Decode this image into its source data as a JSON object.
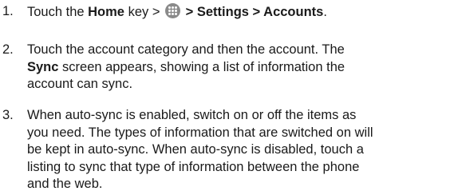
{
  "steps": [
    {
      "number": "1.",
      "lines": [
        {
          "segments": [
            {
              "text": "Touch the ",
              "bold": false
            },
            {
              "text": "Home",
              "bold": true
            },
            {
              "text": " key > ",
              "bold": false
            },
            {
              "icon": "apps-icon"
            },
            {
              "text": " > Settings > Accounts",
              "bold": true
            },
            {
              "text": ".",
              "bold": false
            }
          ]
        }
      ]
    },
    {
      "number": "2.",
      "lines": [
        {
          "segments": [
            {
              "text": "Touch the account category and then the account. The",
              "bold": false
            }
          ]
        },
        {
          "segments": [
            {
              "text": "Sync",
              "bold": true
            },
            {
              "text": " screen appears, showing a list of information the",
              "bold": false
            }
          ]
        },
        {
          "segments": [
            {
              "text": "account can sync.",
              "bold": false
            }
          ]
        }
      ]
    },
    {
      "number": "3.",
      "lines": [
        {
          "segments": [
            {
              "text": "When auto-sync is enabled, switch on or off the items as",
              "bold": false
            }
          ]
        },
        {
          "segments": [
            {
              "text": "you need. The types of information that are switched on will",
              "bold": false
            }
          ]
        },
        {
          "segments": [
            {
              "text": "be kept in auto-sync. When auto-sync is disabled, touch a",
              "bold": false
            }
          ]
        },
        {
          "segments": [
            {
              "text": "listing to sync that type of information between the phone",
              "bold": false
            }
          ]
        },
        {
          "segments": [
            {
              "text": "and the web.",
              "bold": false
            }
          ]
        }
      ]
    }
  ]
}
